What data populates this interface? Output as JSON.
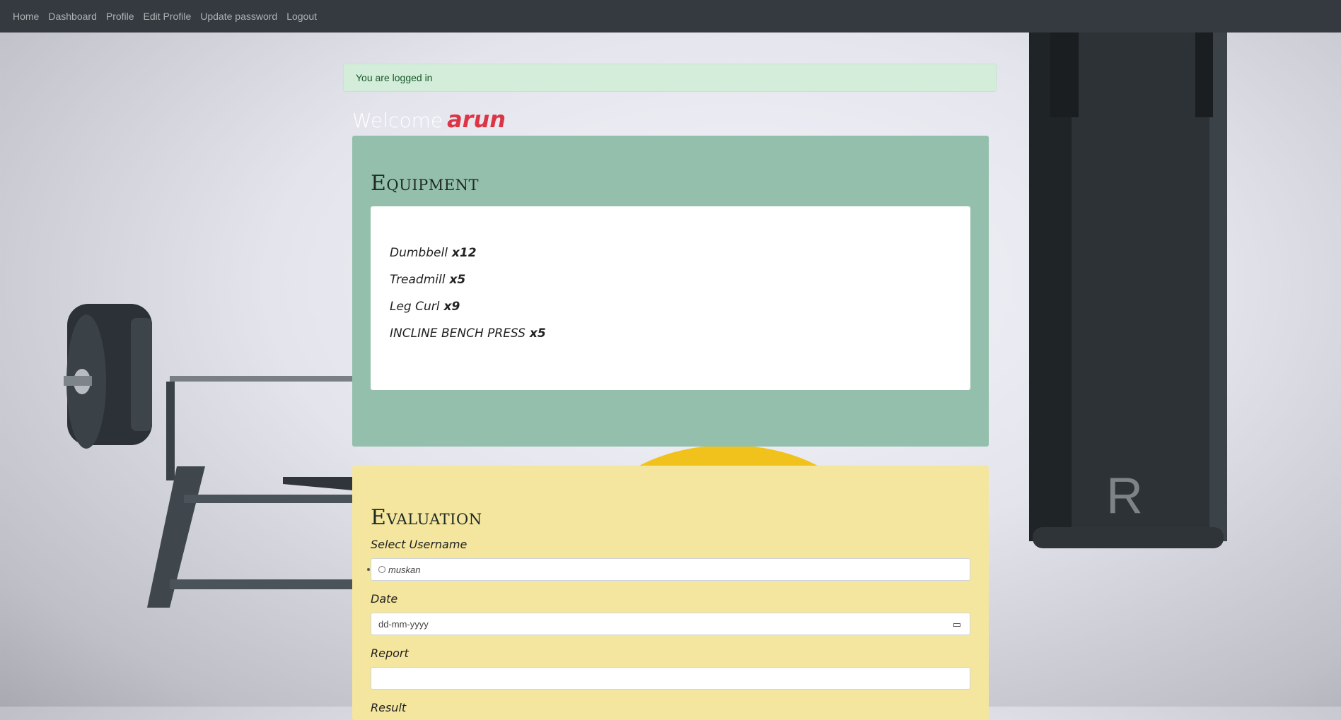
{
  "nav": {
    "items": [
      "Home",
      "Dashboard",
      "Profile",
      "Edit Profile",
      "Update password",
      "Logout"
    ]
  },
  "alert": {
    "text": "You are logged in"
  },
  "welcome": {
    "prefix": "Welcome",
    "username": "arun"
  },
  "equipment": {
    "title": "Equipment",
    "items": [
      {
        "name": "Dumbbell",
        "qty": "x12"
      },
      {
        "name": "Treadmill",
        "qty": "x5"
      },
      {
        "name": "Leg Curl",
        "qty": "x9"
      },
      {
        "name": "INCLINE BENCH PRESS",
        "qty": "x5"
      }
    ]
  },
  "evaluation": {
    "title": "Evaluation",
    "select_username_label": "Select Username",
    "username_option": "muskan",
    "date_label": "Date",
    "date_placeholder": "dd-mm-yyyy",
    "report_label": "Report",
    "result_label": "Result"
  },
  "colors": {
    "navbar": "#343a40",
    "equipment_card": "#94bfac",
    "evaluation_card": "#f4e69f",
    "username_accent": "#dc3545",
    "alert_bg": "#d4eddb"
  },
  "icons": [
    "calendar-icon",
    "radio-icon"
  ]
}
